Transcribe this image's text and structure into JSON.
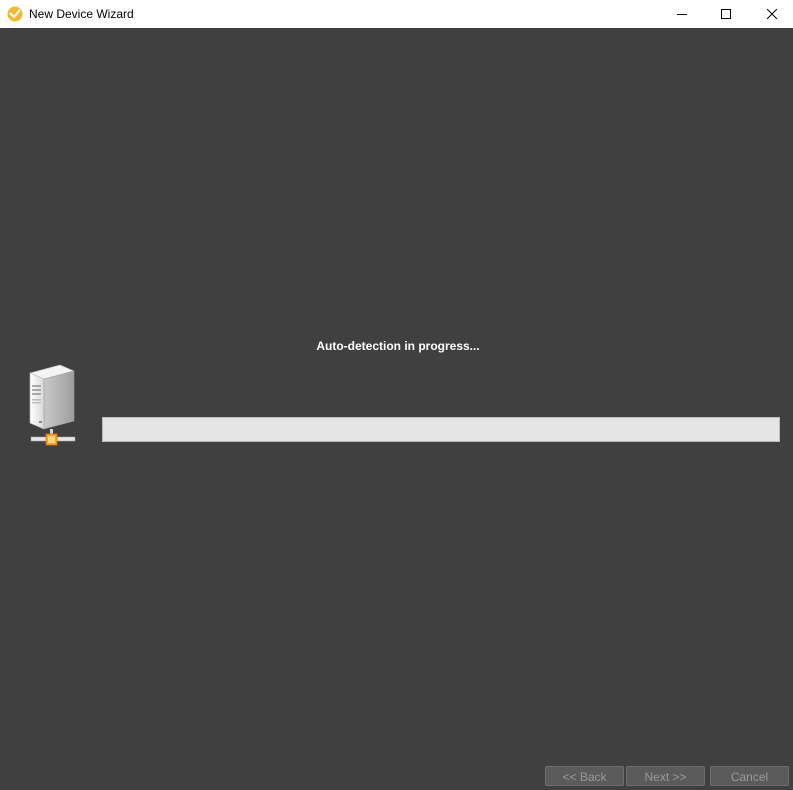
{
  "window": {
    "title": "New Device Wizard",
    "title_icon": "app-logo-icon",
    "controls": {
      "minimize": "minimize-icon",
      "maximize": "maximize-icon",
      "close": "close-icon"
    }
  },
  "main": {
    "status": "Auto-detection in progress...",
    "device_icon": "network-server-icon",
    "progress_fraction": 0.0
  },
  "footer": {
    "back_label": "<< Back",
    "next_label": "Next >>",
    "cancel_label": "Cancel",
    "buttons_enabled": false
  },
  "colors": {
    "background": "#404040",
    "titlebar": "#ffffff",
    "accent_logo": "#f5b82e",
    "progress_track": "#e4e4e4",
    "button_bg": "#5b5b5b",
    "button_text_disabled": "#9a9a9a"
  }
}
